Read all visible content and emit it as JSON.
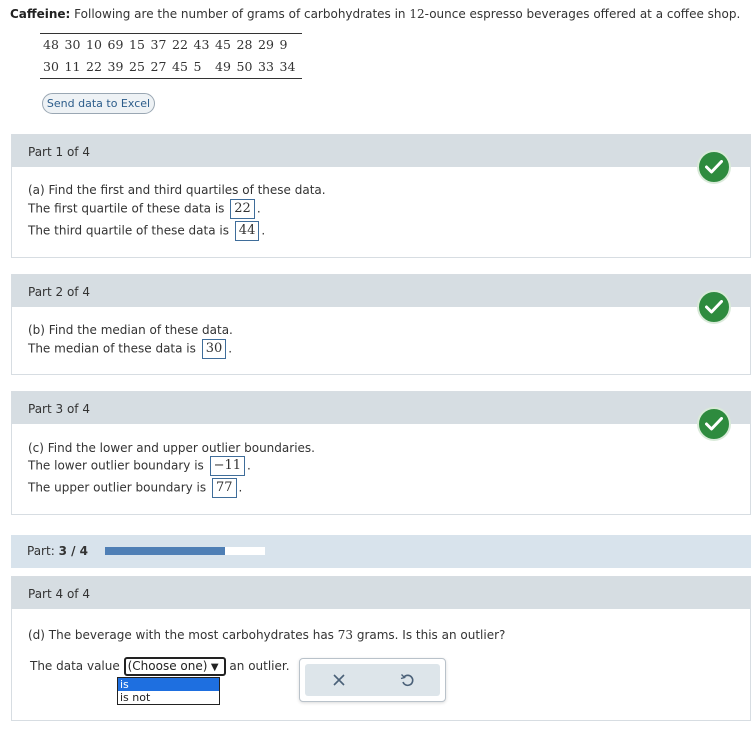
{
  "header": {
    "bold": "Caffeine:",
    "text_before_num": " Following are the number of grams of carbohydrates in ",
    "num": "12",
    "text_after_num": "-ounce espresso beverages offered at a coffee shop."
  },
  "data_rows": [
    [
      "48",
      "30",
      "10",
      "69",
      "15",
      "37",
      "22",
      "43",
      "45",
      "28",
      "29",
      "9"
    ],
    [
      "30",
      "11",
      "22",
      "39",
      "25",
      "27",
      "45",
      "5",
      "49",
      "50",
      "33",
      "34"
    ]
  ],
  "excel_button": "Send data to Excel",
  "parts": [
    {
      "header": "Part 1 of 4",
      "question": "(a) Find the first and third quartiles of these data.",
      "lines": [
        {
          "prefix": "The first quartile of these data is",
          "answer": "22",
          "suffix": "."
        },
        {
          "prefix": "The third quartile of these data is",
          "answer": "44",
          "suffix": "."
        }
      ]
    },
    {
      "header": "Part 2 of 4",
      "question": "(b) Find the median of these data.",
      "lines": [
        {
          "prefix": "The median of these data is",
          "answer": "30",
          "suffix": "."
        }
      ]
    },
    {
      "header": "Part 3 of 4",
      "question": "(c) Find the lower and upper outlier boundaries.",
      "lines": [
        {
          "prefix": "The lower outlier boundary is",
          "answer": "−11",
          "suffix": "."
        },
        {
          "prefix": "The upper outlier boundary is",
          "answer": "77",
          "suffix": "."
        }
      ]
    },
    {
      "header": "Part 4 of 4",
      "question_before_num": "(d) The beverage with the most carbohydrates has ",
      "question_num": "73",
      "question_after_num": " grams. Is this an outlier?",
      "answer_prefix": "The data value",
      "answer_suffix": "an outlier.",
      "select_value": "(Choose one)",
      "options": [
        "is",
        "is not"
      ]
    }
  ],
  "progress": {
    "label": "Part:",
    "value": "3 / 4",
    "fraction": 0.75
  },
  "colors": {
    "check_green": "#2e8b3e",
    "progress_fill": "#4f7fb5",
    "part_header_bg": "#d6dde2",
    "answer_border": "#3f6d9a",
    "selected_option": "#1e6fe0"
  },
  "icons": {
    "check": "check-icon",
    "close": "close-icon",
    "undo": "undo-icon",
    "dropdown_arrow": "dropdown-arrow-icon"
  }
}
